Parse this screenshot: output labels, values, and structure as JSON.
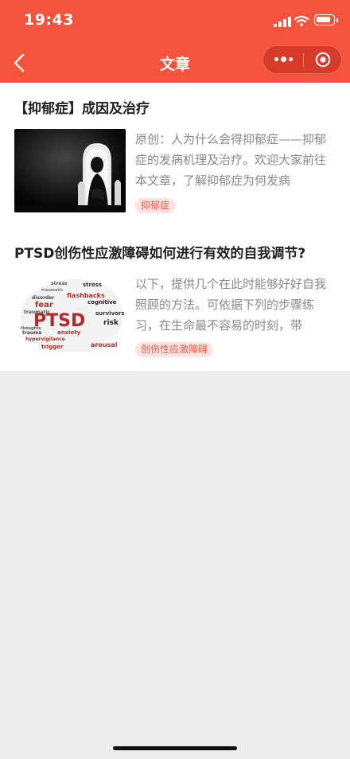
{
  "status_bar": {
    "time": "19:43"
  },
  "nav": {
    "title": "文章"
  },
  "articles": [
    {
      "title": "【抑郁症】成因及治疗",
      "summary": "原创：人为什么会得抑郁症——抑郁症的发病机理及治疗。欢迎大家前往本文章，了解抑郁症为何发病",
      "tag": "抑郁症"
    },
    {
      "title": "PTSD创伤性应激障碍如何进行有效的自我调节?",
      "summary": "以下，提供几个在此时能够好好自我照顾的方法。可依据下列的步骤练习，在生命最不容易的时刻，带",
      "tag": "创伤性应激障碍",
      "thumbnail_words": [
        "PTSD",
        "fear",
        "flashbacks",
        "cognitive",
        "anxiety",
        "trauma",
        "risk",
        "hypervigilance",
        "arousal",
        "trigger",
        "survivors",
        "thoughts",
        "stress",
        "disorder",
        "traumatic"
      ]
    }
  ],
  "colors": {
    "accent": "#f6533d",
    "tag_bg": "#fde2df",
    "background": "#ededed"
  },
  "icons": [
    "back-arrow-icon",
    "more-dots-icon",
    "close-ring-icon",
    "signal-icon",
    "wifi-icon",
    "battery-icon"
  ]
}
